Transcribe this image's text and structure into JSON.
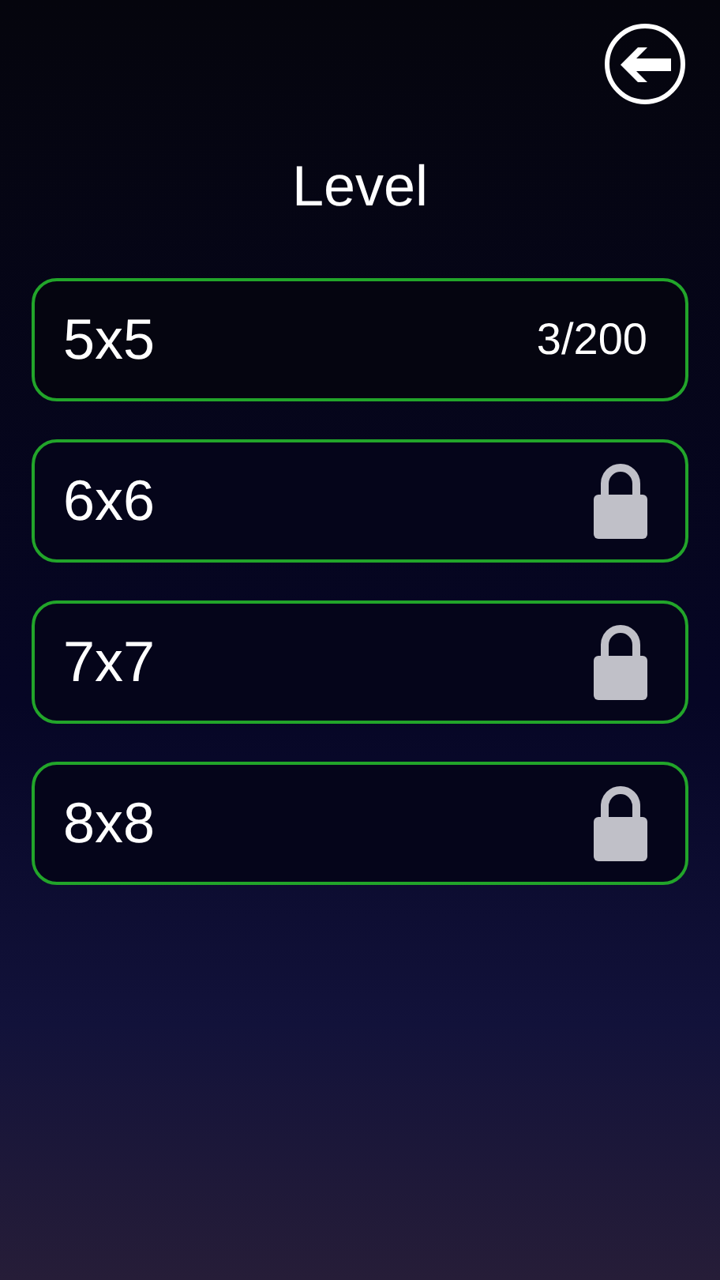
{
  "title": "Level",
  "levels": [
    {
      "label": "5x5",
      "locked": false,
      "progress": "3/200"
    },
    {
      "label": "6x6",
      "locked": true
    },
    {
      "label": "7x7",
      "locked": true
    },
    {
      "label": "8x8",
      "locked": true
    }
  ]
}
